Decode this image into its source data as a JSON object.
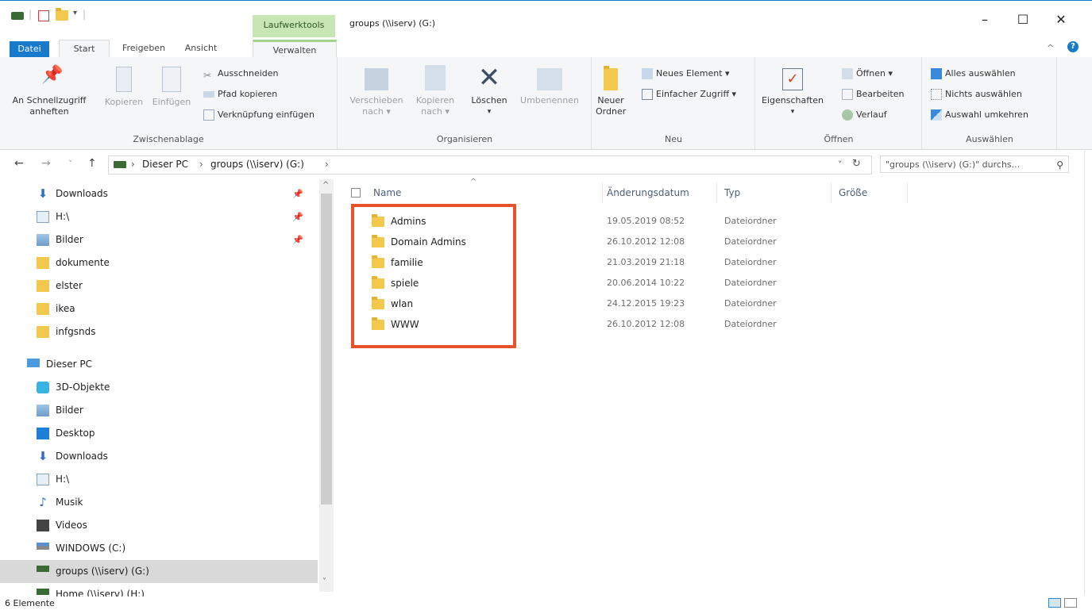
{
  "window": {
    "title": "groups (\\\\iserv) (G:)",
    "context_tab": "Laufwerktools",
    "controls": {
      "minimize": "–",
      "maximize": "☐",
      "close": "✕"
    }
  },
  "tabs": {
    "datei": "Datei",
    "start": "Start",
    "freigeben": "Freigeben",
    "ansicht": "Ansicht",
    "verwalten": "Verwalten"
  },
  "ribbon": {
    "zwischenablage": {
      "label": "Zwischenablage",
      "pin_line1": "An Schnellzugriff",
      "pin_line2": "anheften",
      "kopieren": "Kopieren",
      "einfuegen": "Einfügen",
      "ausschneiden": "Ausschneiden",
      "pfad_kopieren": "Pfad kopieren",
      "verknuepfung": "Verknüpfung einfügen"
    },
    "organisieren": {
      "label": "Organisieren",
      "verschieben_line1": "Verschieben",
      "verschieben_line2": "nach ▾",
      "kopieren_line1": "Kopieren",
      "kopieren_line2": "nach ▾",
      "loeschen": "Löschen",
      "loeschen_arrow": "▾",
      "umbenennen": "Umbenennen"
    },
    "neu": {
      "label": "Neu",
      "neuer_ordner_line1": "Neuer",
      "neuer_ordner_line2": "Ordner",
      "neues_element": "Neues Element ▾",
      "einfacher_zugriff": "Einfacher Zugriff ▾"
    },
    "oeffnen": {
      "label": "Öffnen",
      "eigenschaften": "Eigenschaften",
      "eigenschaften_arrow": "▾",
      "oeffnen": "Öffnen ▾",
      "bearbeiten": "Bearbeiten",
      "verlauf": "Verlauf"
    },
    "auswaehlen": {
      "label": "Auswählen",
      "alles": "Alles auswählen",
      "nichts": "Nichts auswählen",
      "umkehren": "Auswahl umkehren"
    },
    "collapse": "^",
    "help": "?"
  },
  "address": {
    "back": "←",
    "forward": "→",
    "recent": "˅",
    "up": "↑",
    "crumb_sep1": "›",
    "crumb1": "Dieser PC",
    "crumb_sep2": "›",
    "crumb2": "groups (\\\\iserv) (G:)",
    "crumb_sep3": "›",
    "dropdown": "˅",
    "refresh": "↻",
    "search_placeholder": "\"groups (\\\\iserv) (G:)\" durchs...",
    "search_icon": "⚲"
  },
  "nav": {
    "quick": [
      {
        "label": "Downloads",
        "icon": "download-icon",
        "pin": "📌"
      },
      {
        "label": "H:\\",
        "icon": "drive-icon",
        "pin": "📌"
      },
      {
        "label": "Bilder",
        "icon": "pictures-icon",
        "pin": "📌"
      },
      {
        "label": "dokumente",
        "icon": "folder-icon"
      },
      {
        "label": "elster",
        "icon": "folder-icon"
      },
      {
        "label": "ikea",
        "icon": "folder-icon"
      },
      {
        "label": "infgsnds",
        "icon": "folder-icon"
      }
    ],
    "pc": [
      {
        "label": "Dieser PC",
        "icon": "computer-icon"
      },
      {
        "label": "3D-Objekte",
        "icon": "3d-objects-icon"
      },
      {
        "label": "Bilder",
        "icon": "pictures-icon"
      },
      {
        "label": "Desktop",
        "icon": "desktop-icon"
      },
      {
        "label": "Downloads",
        "icon": "download-icon"
      },
      {
        "label": "H:\\",
        "icon": "drive-icon"
      },
      {
        "label": "Musik",
        "icon": "music-icon"
      },
      {
        "label": "Videos",
        "icon": "videos-icon"
      },
      {
        "label": "WINDOWS (C:)",
        "icon": "windows-drive-icon"
      },
      {
        "label": "groups (\\\\iserv) (G:)",
        "icon": "network-drive-icon"
      },
      {
        "label": "Home (\\\\iserv) (H:)",
        "icon": "network-drive-icon"
      }
    ]
  },
  "files": {
    "columns": {
      "name": "Name",
      "date": "Änderungsdatum",
      "type": "Typ",
      "size": "Größe"
    },
    "sort_indicator": "^",
    "rows": [
      {
        "name": "Admins",
        "date": "19.05.2019 08:52",
        "type": "Dateiordner"
      },
      {
        "name": "Domain Admins",
        "date": "26.10.2012 12:08",
        "type": "Dateiordner"
      },
      {
        "name": "familie",
        "date": "21.03.2019 21:18",
        "type": "Dateiordner"
      },
      {
        "name": "spiele",
        "date": "20.06.2014 10:22",
        "type": "Dateiordner"
      },
      {
        "name": "wlan",
        "date": "24.12.2015 19:23",
        "type": "Dateiordner"
      },
      {
        "name": "WWW",
        "date": "26.10.2012 12:08",
        "type": "Dateiordner"
      }
    ]
  },
  "status": {
    "count": "6 Elemente"
  },
  "colors": {
    "accent": "#1979ca",
    "highlight": "#e8532b",
    "folder": "#f2c94c",
    "context_tab": "#c8e6b4"
  }
}
